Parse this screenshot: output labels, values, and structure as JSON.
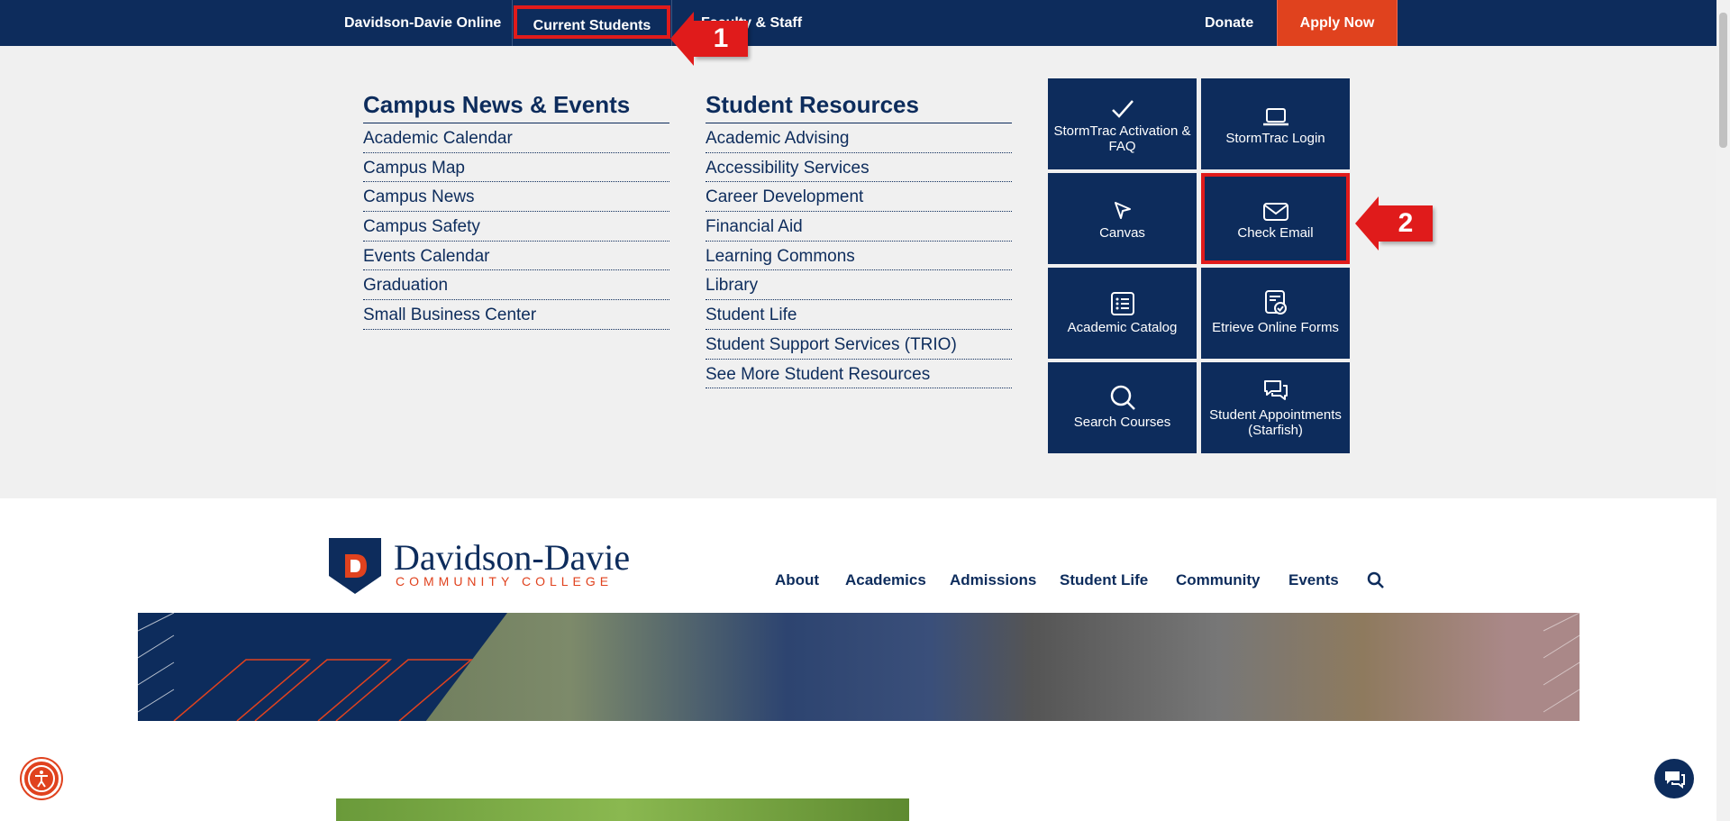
{
  "topbar": {
    "online": "Davidson-Davie Online",
    "current_students": "Current Students",
    "faculty_staff": "Faculty & Staff",
    "donate": "Donate",
    "apply": "Apply Now"
  },
  "callouts": [
    "1",
    "2"
  ],
  "mega_menu": {
    "campus_news": {
      "heading": "Campus News & Events",
      "links": [
        "Academic Calendar",
        "Campus Map",
        "Campus News",
        "Campus Safety",
        "Events Calendar",
        "Graduation",
        "Small Business Center"
      ]
    },
    "student_resources": {
      "heading": "Student Resources",
      "links": [
        "Academic Advising",
        "Accessibility Services",
        "Career Development",
        "Financial Aid",
        "Learning Commons",
        "Library",
        "Student Life",
        "Student Support Services (TRIO)",
        "See More Student Resources"
      ]
    },
    "tiles": [
      {
        "label": "StormTrac Activation & FAQ",
        "icon": "check-icon"
      },
      {
        "label": "StormTrac Login",
        "icon": "laptop-icon"
      },
      {
        "label": "Canvas",
        "icon": "cursor-icon"
      },
      {
        "label": "Check Email",
        "icon": "envelope-icon"
      },
      {
        "label": "Academic Catalog",
        "icon": "list-icon"
      },
      {
        "label": "Etrieve Online Forms",
        "icon": "form-check-icon"
      },
      {
        "label": "Search Courses",
        "icon": "search-icon"
      },
      {
        "label": "Student Appointments (Starfish)",
        "icon": "chat-icon"
      }
    ]
  },
  "header": {
    "logo_name": "Davidson-Davie",
    "logo_sub": "COMMUNITY COLLEGE",
    "nav": [
      "About",
      "Academics",
      "Admissions",
      "Student Life",
      "Community",
      "Events"
    ]
  },
  "colors": {
    "navy": "#0d2c5c",
    "orange": "#e0421e",
    "callout_red": "#e01b1b"
  }
}
